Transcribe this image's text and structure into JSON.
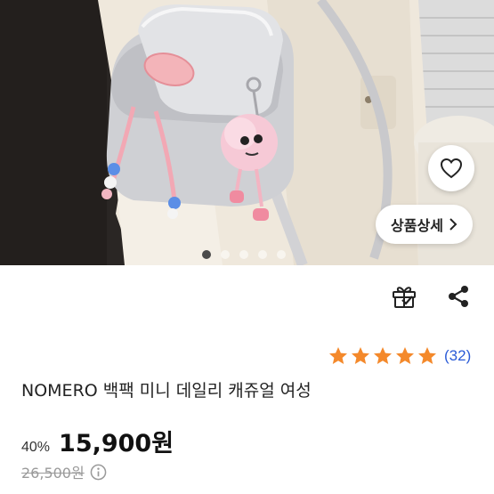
{
  "product": {
    "title": "NOMERO 백팩 미니 데일리 캐쥬얼 여성",
    "image_alt": "product-photo-backpack"
  },
  "gallery": {
    "total_slides": 5,
    "active_slide": 1
  },
  "actions": {
    "wishlist_icon": "heart-outline-icon",
    "detail_label": "상품상세",
    "detail_icon": "chevron-right-icon",
    "gift_icon": "gift-icon",
    "share_icon": "share-icon"
  },
  "rating": {
    "stars": 5,
    "review_count": "(32)",
    "star_color": "#f4892b"
  },
  "price": {
    "discount": "40%",
    "sale_price": "15,900원",
    "original_price": "26,500원",
    "info_icon": "info-circle-icon"
  }
}
